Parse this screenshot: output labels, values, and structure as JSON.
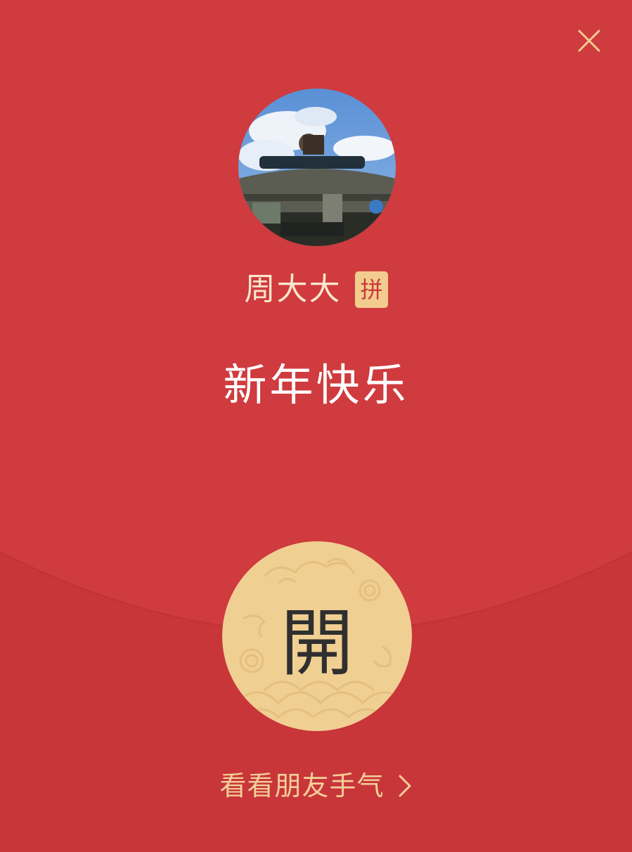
{
  "envelope": {
    "sender_name": "周大大",
    "group_badge": "拼",
    "greeting": "新年快乐",
    "open_label": "開",
    "friends_link": "看看朋友手气"
  },
  "icons": {
    "close": "close-icon",
    "avatar": "avatar-photo",
    "chevron": "chevron-right-icon"
  },
  "colors": {
    "envelope_red": "#cf3b3e",
    "flap_red": "#c8363a",
    "gold": "#f2cc8f",
    "name_text": "#fbe6cd",
    "link_text": "#f4cf98"
  }
}
